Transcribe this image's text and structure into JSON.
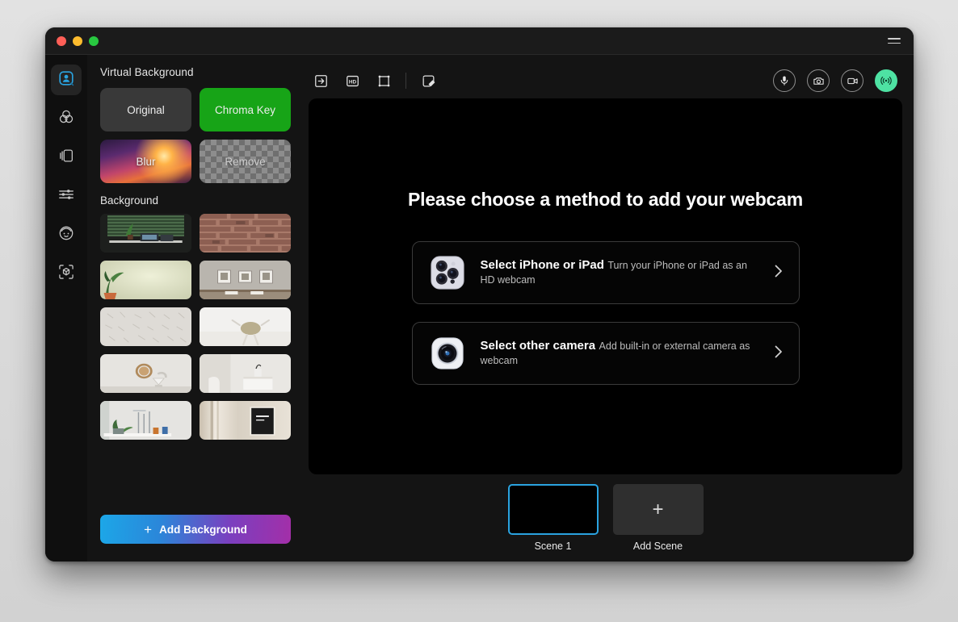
{
  "window": {
    "traffic_lights": [
      "close",
      "minimize",
      "zoom"
    ],
    "menu_icon": "hamburger-icon"
  },
  "rail": {
    "items": [
      {
        "name": "virtual-background",
        "icon": "person-in-frame-icon",
        "active": true
      },
      {
        "name": "filters",
        "icon": "color-circles-icon",
        "active": false
      },
      {
        "name": "layers",
        "icon": "stacked-cards-icon",
        "active": false
      },
      {
        "name": "adjustments",
        "icon": "sliders-icon",
        "active": false
      },
      {
        "name": "avatar",
        "icon": "face-icon",
        "active": false
      },
      {
        "name": "ar-objects",
        "icon": "cube-scan-icon",
        "active": false
      }
    ]
  },
  "left_panel": {
    "title": "Virtual Background",
    "modes": [
      {
        "label": "Original",
        "style": "plain"
      },
      {
        "label": "Chroma Key",
        "style": "green"
      },
      {
        "label": "Blur",
        "style": "image"
      },
      {
        "label": "Remove",
        "style": "checker"
      }
    ],
    "background_label": "Background",
    "backgrounds": [
      {
        "name": "desk-with-blinds"
      },
      {
        "name": "brick-wall"
      },
      {
        "name": "plant-cream-wall"
      },
      {
        "name": "gallery-wall"
      },
      {
        "name": "textured-white-wall"
      },
      {
        "name": "white-wall-lamp"
      },
      {
        "name": "mirror-and-lamp"
      },
      {
        "name": "white-room-console"
      },
      {
        "name": "shelf-with-plants"
      },
      {
        "name": "dark-poster-wall"
      }
    ],
    "add_background_label": "Add Background",
    "add_icon": "plus-icon"
  },
  "toolbar": {
    "left_tools": [
      {
        "name": "export-icon",
        "label": "Export"
      },
      {
        "name": "hd-icon",
        "label": "HD"
      },
      {
        "name": "crop-icon",
        "label": "Crop"
      }
    ],
    "right_of_separator": [
      {
        "name": "tag-icon",
        "label": "Tag"
      }
    ],
    "controls": [
      {
        "name": "microphone-icon",
        "label": "Microphone",
        "state": "off"
      },
      {
        "name": "snapshot-camera-icon",
        "label": "Snapshot",
        "state": "off"
      },
      {
        "name": "video-camera-icon",
        "label": "Video",
        "state": "off"
      },
      {
        "name": "broadcast-icon",
        "label": "Go Live",
        "state": "on",
        "color": "#4ee2a3"
      }
    ]
  },
  "stage": {
    "title": "Please choose a method to add your webcam",
    "options": [
      {
        "icon": "iphone-camera-module-icon",
        "title": "Select iPhone or iPad",
        "subtitle": "Turn your iPhone or iPad as an HD webcam",
        "chevron": "chevron-right-icon"
      },
      {
        "icon": "camera-lens-icon",
        "title": "Select other camera",
        "subtitle": "Add built-in or external camera as webcam",
        "chevron": "chevron-right-icon"
      }
    ]
  },
  "scenes": {
    "items": [
      {
        "label": "Scene 1",
        "selected": true
      }
    ],
    "add_label": "Add Scene",
    "add_icon": "plus-icon"
  },
  "colors": {
    "accent_blue": "#2aa3e0",
    "live_green": "#4ee2a3",
    "chroma_green": "#17a417",
    "window_bg": "#141414",
    "rail_bg": "#0f0f0f",
    "stage_bg": "#000000"
  }
}
